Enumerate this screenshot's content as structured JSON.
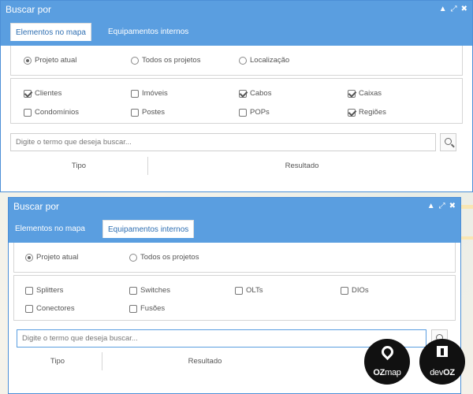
{
  "panel_top": {
    "title": "Buscar por",
    "tabs": [
      {
        "label": "Elementos no mapa",
        "active": true
      },
      {
        "label": "Equipamentos internos",
        "active": false
      }
    ],
    "radios": [
      {
        "label": "Projeto atual",
        "checked": true
      },
      {
        "label": "Todos os projetos",
        "checked": false
      },
      {
        "label": "Localização",
        "checked": false
      }
    ],
    "checkboxes": [
      {
        "label": "Clientes",
        "checked": true
      },
      {
        "label": "Imóveis",
        "checked": false
      },
      {
        "label": "Cabos",
        "checked": true
      },
      {
        "label": "Caixas",
        "checked": true
      },
      {
        "label": "Condomínios",
        "checked": false
      },
      {
        "label": "Postes",
        "checked": false
      },
      {
        "label": "POPs",
        "checked": false
      },
      {
        "label": "Regiões",
        "checked": true
      }
    ],
    "search_placeholder": "Digite o termo que deseja buscar...",
    "columns": [
      "Tipo",
      "Resultado"
    ]
  },
  "panel_bottom": {
    "title": "Buscar por",
    "tabs": [
      {
        "label": "Elementos no mapa",
        "active": false
      },
      {
        "label": "Equipamentos internos",
        "active": true
      }
    ],
    "radios": [
      {
        "label": "Projeto atual",
        "checked": true
      },
      {
        "label": "Todos os projetos",
        "checked": false
      }
    ],
    "checkboxes": [
      {
        "label": "Splitters",
        "checked": false
      },
      {
        "label": "Switches",
        "checked": false
      },
      {
        "label": "OLTs",
        "checked": false
      },
      {
        "label": "DIOs",
        "checked": false
      },
      {
        "label": "Conectores",
        "checked": false
      },
      {
        "label": "Fusões",
        "checked": false
      }
    ],
    "search_placeholder": "Digite o termo que deseja buscar...",
    "columns": [
      "Tipo",
      "Resultado"
    ]
  },
  "window_icons": [
    "minimize-icon",
    "expand-icon",
    "close-icon"
  ],
  "logos": {
    "ozmap": {
      "prefix": "OZ",
      "suffix": "map"
    },
    "devoz": {
      "prefix": "dev",
      "suffix": "OZ"
    }
  },
  "colors": {
    "header_blue": "#5a9ee0",
    "border_blue": "#4c8fd6"
  }
}
